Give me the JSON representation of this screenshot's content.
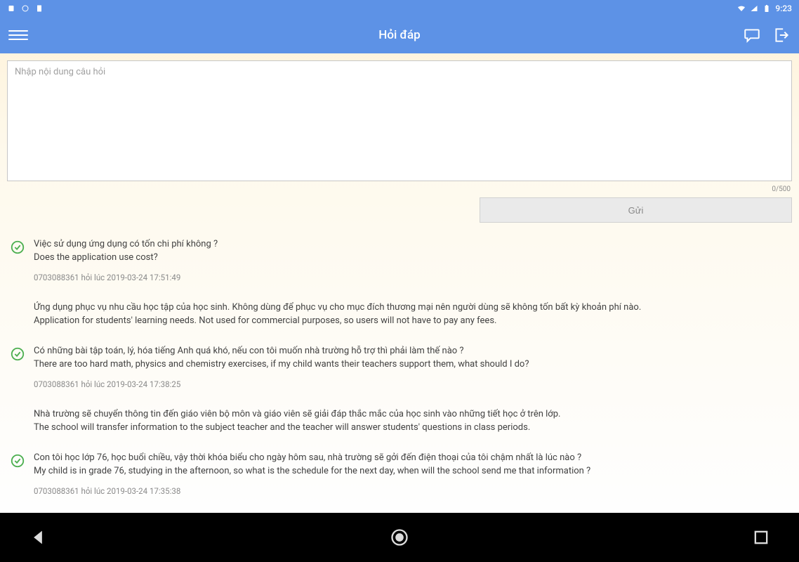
{
  "status": {
    "time": "9:23"
  },
  "appbar": {
    "title": "Hỏi đáp"
  },
  "input": {
    "placeholder": "Nhập nội dung câu hỏi",
    "value": "",
    "counter": "0/500"
  },
  "buttons": {
    "send": "Gửi"
  },
  "qa": [
    {
      "question_vn": "Việc sử dụng ứng dụng có tốn chi phí không ?",
      "question_en": "Does the application use cost?",
      "meta": "0703088361 hỏi lúc 2019-03-24 17:51:49",
      "answer_vn": "Ứng dụng phục vụ nhu cầu học tập của học sinh. Không dùng để phục vụ cho mục đích thương mại nên người dùng sẽ không tốn bất kỳ khoản phí nào.",
      "answer_en": "Application for students' learning needs. Not used for commercial purposes, so users will not have to pay any fees."
    },
    {
      "question_vn": "Có những bài tập toán, lý, hóa tiếng Anh quá khó, nếu con tôi muốn nhà trường hỗ trợ thì phải làm thế nào ?",
      "question_en": "There are too hard math, physics and chemistry exercises, if my child wants their teachers support them, what should I do?",
      "meta": "0703088361 hỏi lúc 2019-03-24 17:38:25",
      "answer_vn": "Nhà trường sẽ chuyển thông tin đến giáo viên bộ môn và giáo viên sẽ giải đáp thắc mắc của học sinh vào những tiết học ở trên lớp.",
      "answer_en": "The school will transfer information to the subject teacher and the teacher will answer students' questions in class periods."
    },
    {
      "question_vn": "Con tôi học lớp 76, học buổi chiều, vậy thời khóa biểu cho ngày hôm sau, nhà trường sẽ gởi đến điện thoại của tôi chậm nhất là lúc nào ?",
      "question_en": "My child is in grade 76, studying in the afternoon, so what is the schedule for the next day, when will the school send me that information ?",
      "meta": "0703088361 hỏi lúc 2019-03-24 17:35:38",
      "answer_vn": "",
      "answer_en": ""
    }
  ]
}
